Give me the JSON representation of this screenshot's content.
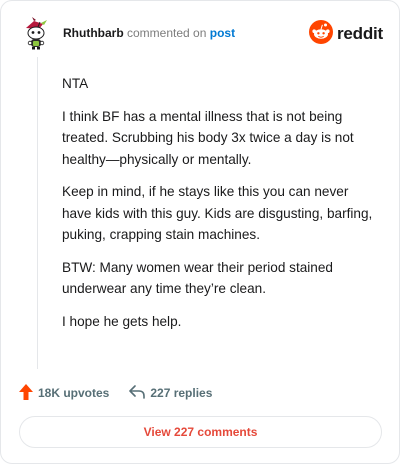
{
  "header": {
    "username": "Rhuthbarb",
    "verb": "commented on",
    "post_link": "post",
    "brand": "reddit"
  },
  "comment": {
    "paragraphs": [
      "NTA",
      "I think BF has a mental illness that is not being treated. Scrubbing his body 3x twice a day is not healthy—physically or mentally.",
      "Keep in mind, if he stays like this you can never have kids with this guy. Kids are disgusting, barfing, puking, crapping stain machines.",
      "BTW: Many women wear their period stained underwear any time they’re clean.",
      "I hope he gets help."
    ]
  },
  "footer": {
    "upvotes": "18K upvotes",
    "replies": "227 replies",
    "view_comments": "View 227 comments"
  },
  "colors": {
    "accent": "#ff4500",
    "link": "#0079d3",
    "button_text": "#e5493a"
  },
  "icons": {
    "avatar": "snoo-avatar-icon",
    "logo": "reddit-logo-icon",
    "upvote": "upvote-arrow-icon",
    "reply": "reply-arrow-icon"
  }
}
